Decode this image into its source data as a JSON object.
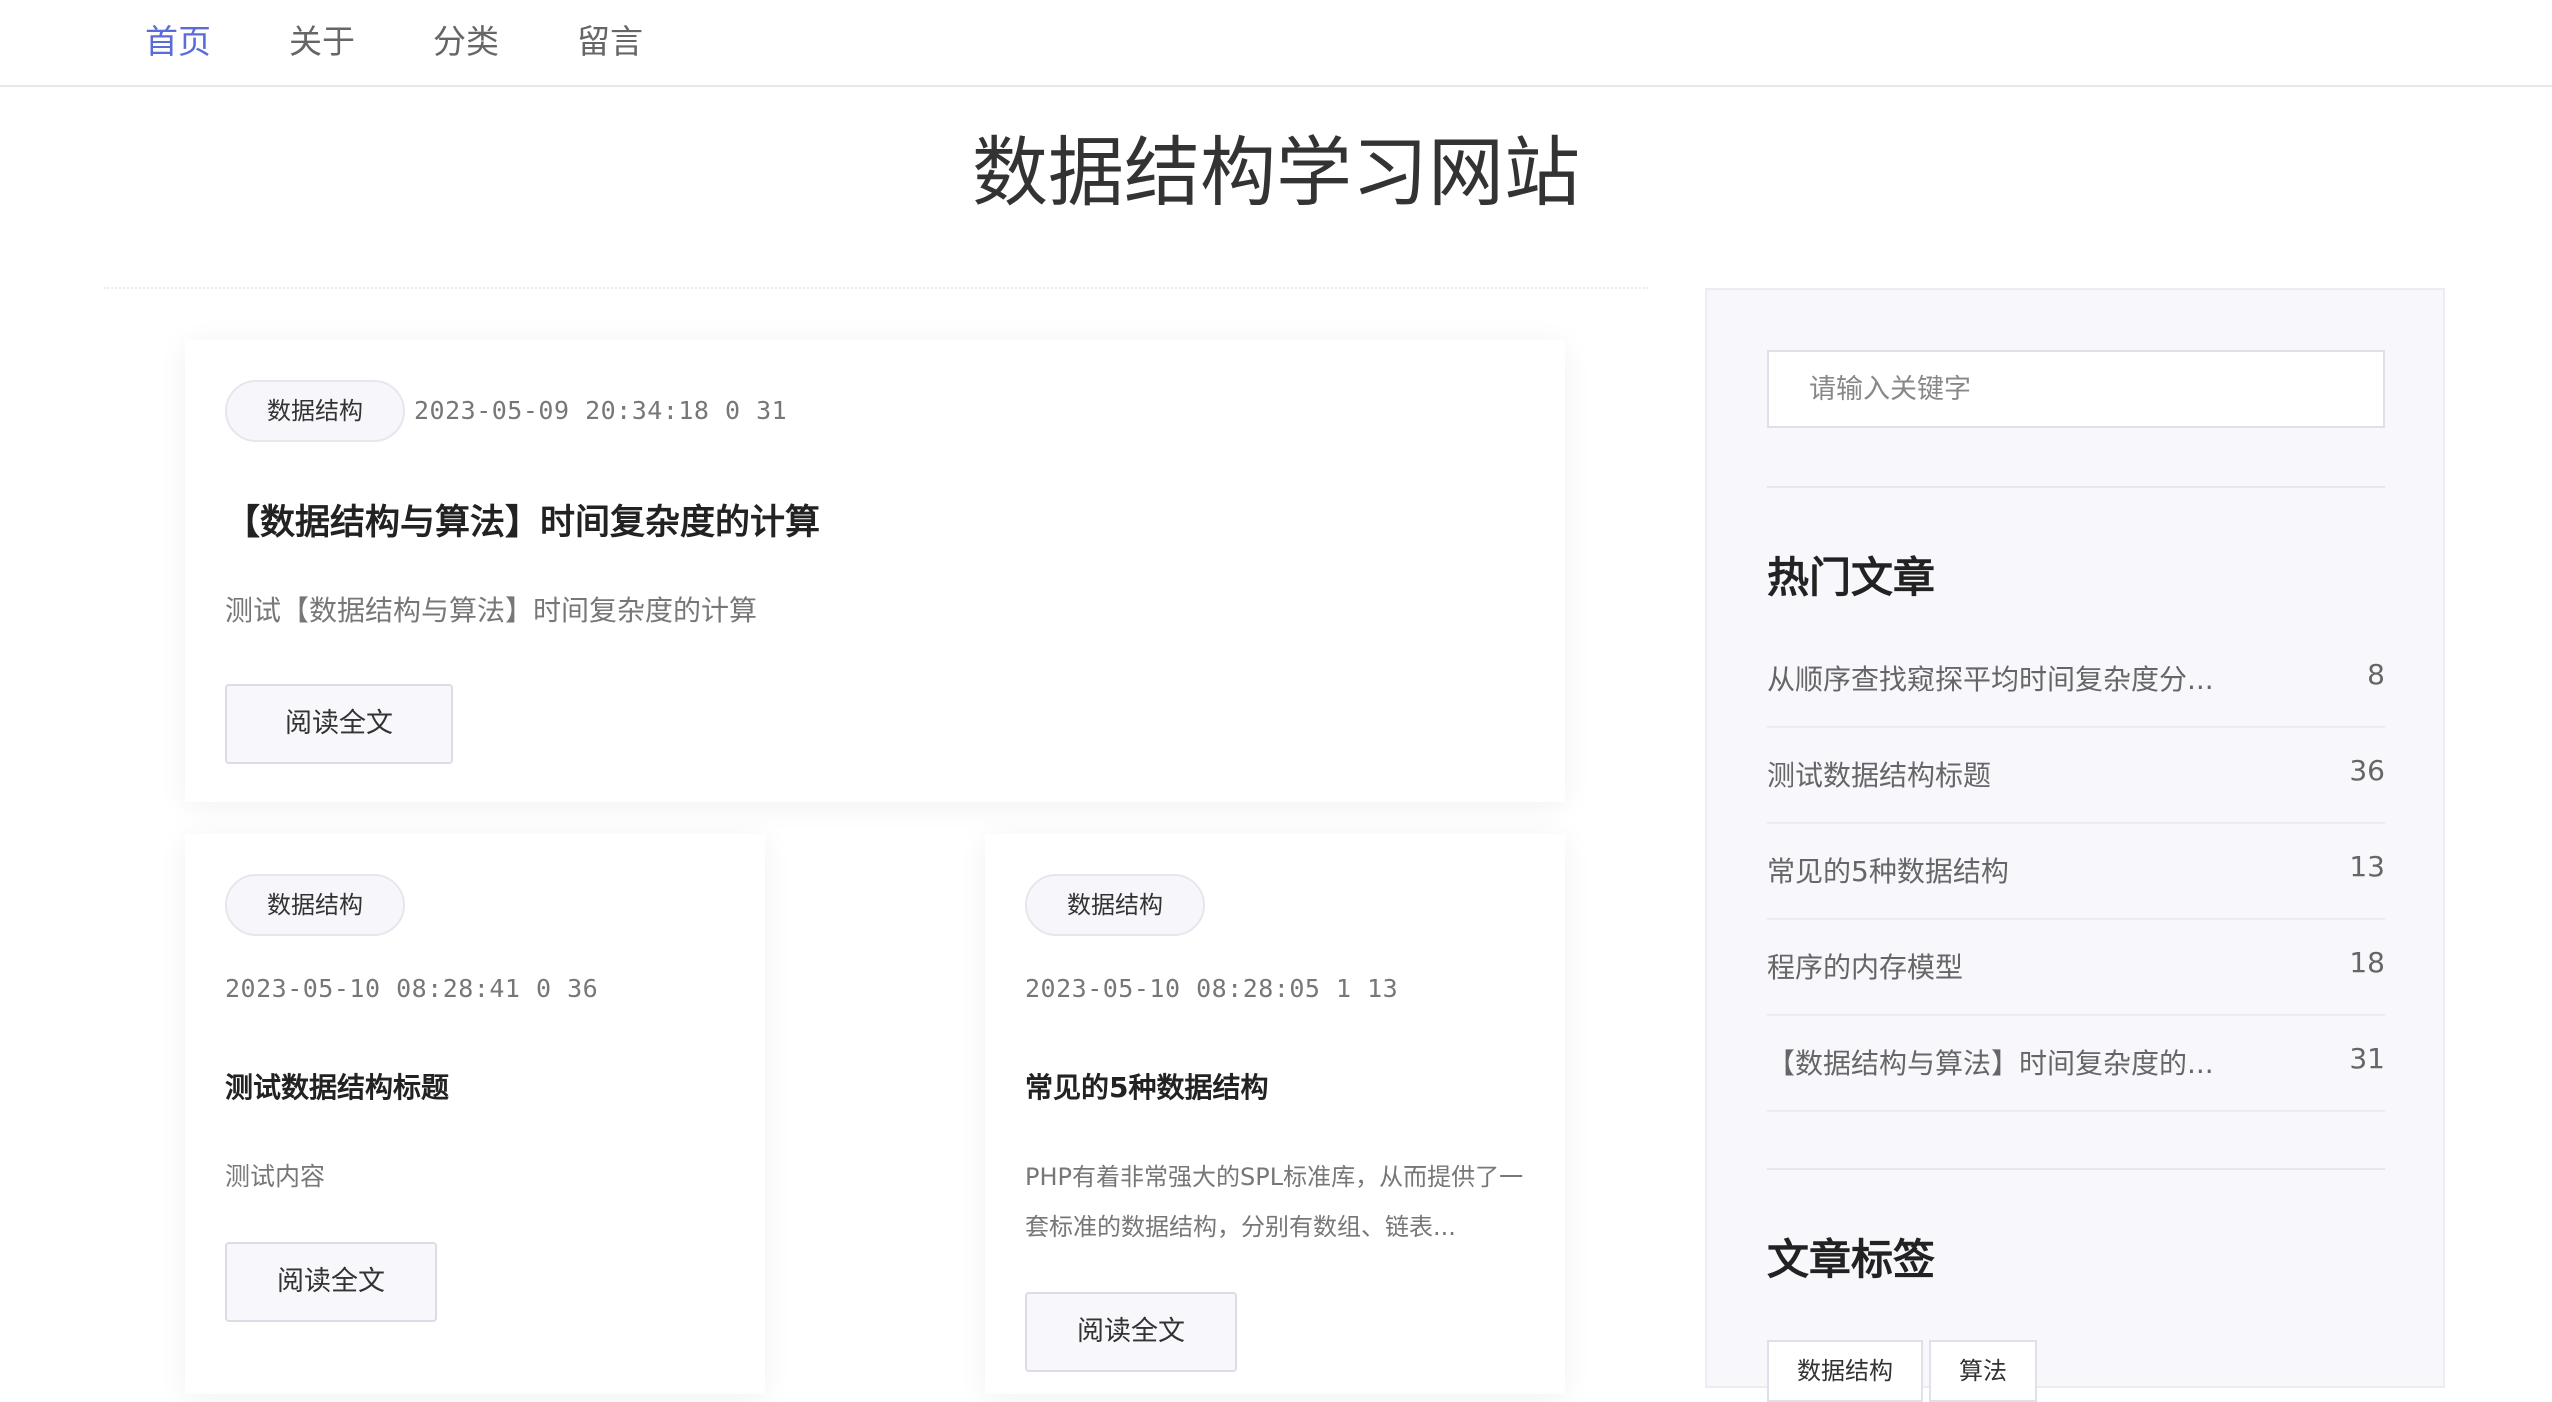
{
  "nav": {
    "items": [
      {
        "label": "首页",
        "active": true
      },
      {
        "label": "关于"
      },
      {
        "label": "分类"
      },
      {
        "label": "留言"
      }
    ]
  },
  "site": {
    "title": "数据结构学习网站"
  },
  "articles": [
    {
      "tag": "数据结构",
      "meta": "2023-05-09 20:34:18 0 31",
      "title": "【数据结构与算法】时间复杂度的计算",
      "desc": "测试【数据结构与算法】时间复杂度的计算",
      "button": "阅读全文"
    },
    {
      "tag": "数据结构",
      "meta": "2023-05-10 08:28:41 0 36",
      "title": "测试数据结构标题",
      "desc": "测试内容",
      "button": "阅读全文"
    },
    {
      "tag": "数据结构",
      "meta": "2023-05-10 08:28:05 1 13",
      "title": "常见的5种数据结构",
      "desc": "PHP有着非常强大的SPL标准库，从而提供了一套标准的数据结构，分别有数组、链表...",
      "button": "阅读全文"
    }
  ],
  "sidebar": {
    "search_placeholder": "请输入关键字",
    "hot_heading": "热门文章",
    "hot_articles": [
      {
        "title": "从顺序查找窥探平均时间复杂度分...",
        "count": "8"
      },
      {
        "title": "测试数据结构标题",
        "count": "36"
      },
      {
        "title": "常见的5种数据结构",
        "count": "13"
      },
      {
        "title": "程序的内存模型",
        "count": "18"
      },
      {
        "title": "【数据结构与算法】时间复杂度的...",
        "count": "31"
      }
    ],
    "tags_heading": "文章标签",
    "tags": [
      "数据结构",
      "算法"
    ]
  },
  "colors": {
    "accent": "#5b6cd9",
    "text": "#333333",
    "muted": "#777777",
    "sidebar_bg": "#f8f8fc"
  }
}
